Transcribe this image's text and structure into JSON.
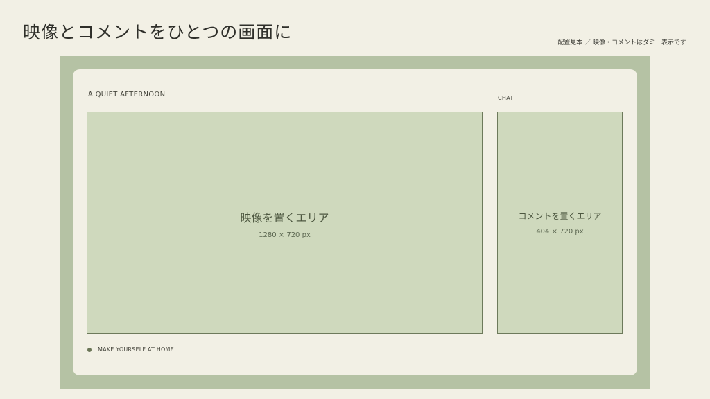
{
  "header": {
    "title": "映像とコメントをひとつの画面に",
    "note": "配置見本 ／ 映像・コメントはダミー表示です"
  },
  "layout": {
    "video_label": "A QUIET AFTERNOON",
    "chat_label": "CHAT",
    "video_area": {
      "title": "映像を置くエリア",
      "size": "1280 × 720 px"
    },
    "chat_area": {
      "title": "コメントを置くエリア",
      "size": "404 × 720 px"
    },
    "footer_text": "MAKE YOURSELF AT HOME"
  },
  "colors": {
    "background": "#f2f0e5",
    "frame": "#b5c2a4",
    "placeholder_fill": "#cfd9bd",
    "placeholder_border": "#6d7a5b",
    "accent_dot": "#6b7657"
  }
}
